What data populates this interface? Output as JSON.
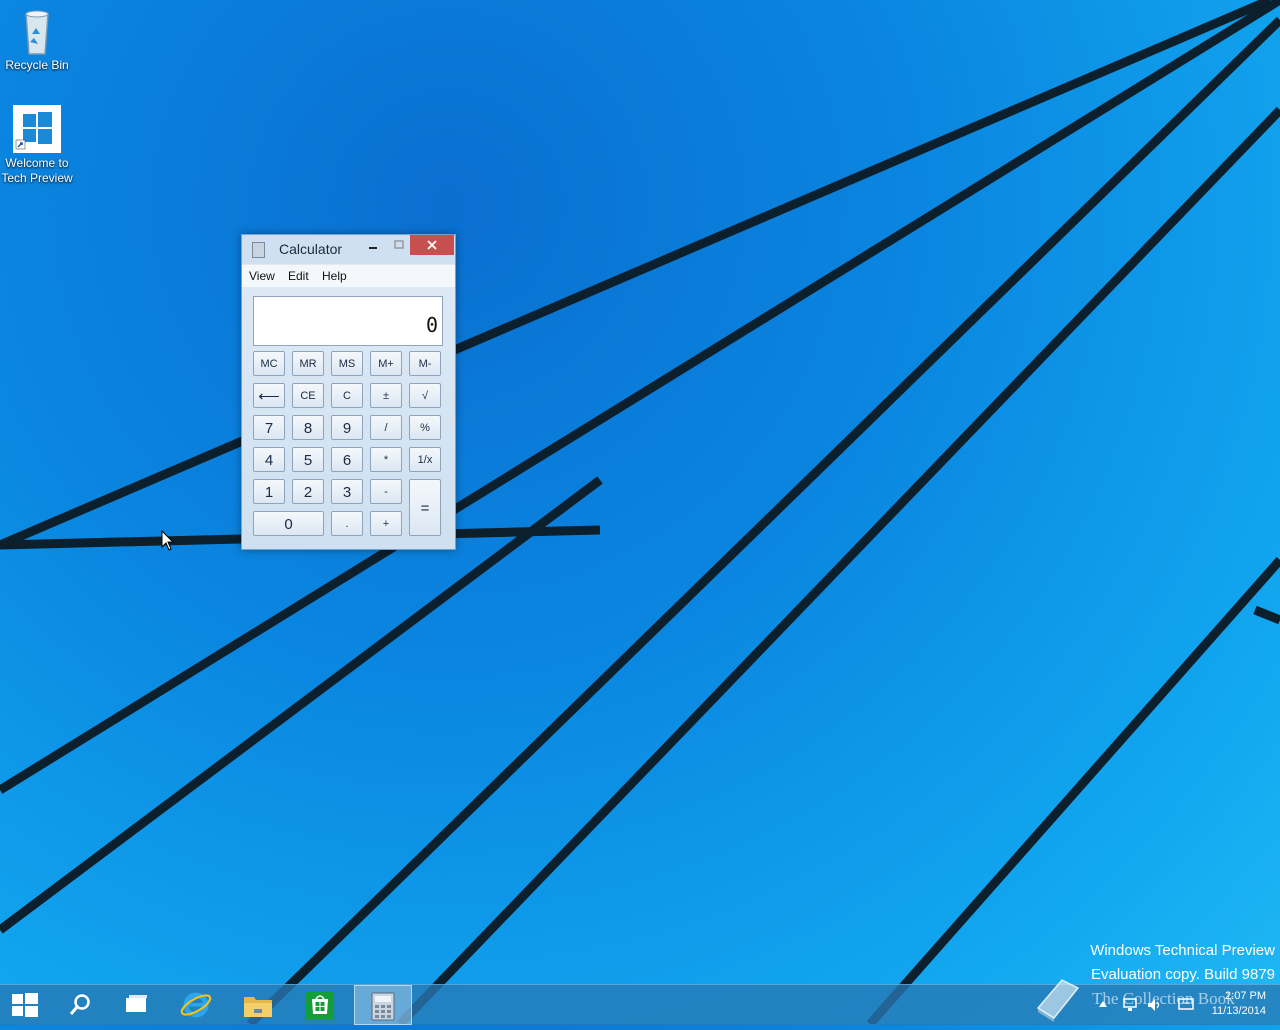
{
  "desktop": {
    "icons": [
      {
        "label": "Recycle Bin",
        "icon": "recycle-bin-icon"
      },
      {
        "label": "Welcome to Tech Preview",
        "icon": "windows-logo-icon"
      }
    ],
    "watermark_line1": "Windows Technical Preview",
    "watermark_line2": "Evaluation copy. Build 9879",
    "overlay_text": "The Collection Book"
  },
  "calculator": {
    "title": "Calculator",
    "menu": [
      "View",
      "Edit",
      "Help"
    ],
    "display": "0",
    "memory_keys": [
      "MC",
      "MR",
      "MS",
      "M+",
      "M-"
    ],
    "row2": [
      "⟵",
      "CE",
      "C",
      "±",
      "√"
    ],
    "row3": [
      "7",
      "8",
      "9",
      "/",
      "%"
    ],
    "row4": [
      "4",
      "5",
      "6",
      "*",
      "1/x"
    ],
    "row5": [
      "1",
      "2",
      "3",
      "-"
    ],
    "row6": [
      "0",
      ".",
      "+"
    ],
    "equals": "="
  },
  "taskbar": {
    "items": [
      "start-icon",
      "search-icon",
      "task-view-icon",
      "internet-explorer-icon",
      "file-explorer-icon",
      "store-icon",
      "calculator-icon"
    ],
    "clock_time": "2:07 PM",
    "clock_date": "11/13/2014"
  },
  "colors": {
    "desktop_blue": "#0a86e0",
    "taskbar": "#2878b4",
    "close_button": "#c7504f"
  }
}
